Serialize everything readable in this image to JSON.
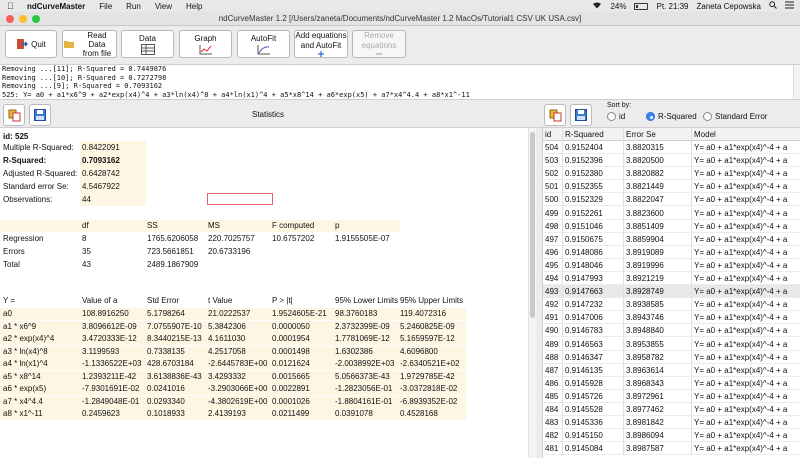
{
  "menubar": {
    "app": "ndCurveMaster",
    "menus": [
      "File",
      "Run",
      "View",
      "Help"
    ],
    "battery": "24%",
    "clock": "Pt. 21:39",
    "user": "Żaneta Cepowska"
  },
  "window": {
    "title": "ndCurveMaster 1.2 [/Users/zaneta/Documents/ndCurveMaster 1.2 MacOs/Tutorial1 CSV UK USA.csv]"
  },
  "toolbar": {
    "quit": "Quit",
    "read_data_1": "Read Data",
    "read_data_2": "from file",
    "data": "Data",
    "graph": "Graph",
    "autofit": "AutoFit",
    "add_eq_1": "Add equations",
    "add_eq_2": "and AutoFit",
    "remove_eq_1": "Remove",
    "remove_eq_2": "equations"
  },
  "log": [
    "Removing ...[11]; R-Squared = 0.7449876",
    "Removing ...[10]; R-Squared = 0.7272798",
    "Removing ...[9]; R-Squared = 0.7093162",
    "525: Y= a0  + a1*x6^9 + a2*exp(x4)^4 + a3*ln(x4)^8 + a4*ln(x1)^4 + a5*x8^14 + a6*exp(x5) + a7*x4^4.4 + a8*x1^-11"
  ],
  "stats": {
    "title": "Statistics",
    "id_label": "id: 525",
    "summary": [
      {
        "k": "Multiple R-Squared:",
        "v": "0.8422091"
      },
      {
        "k": "R-Squared:",
        "v": "0.7093162"
      },
      {
        "k": "Adjusted R-Squared:",
        "v": "0.6428742"
      },
      {
        "k": "Standard error Se:",
        "v": "4.5467922"
      },
      {
        "k": "Observations:",
        "v": "44"
      }
    ],
    "anova_header": [
      "",
      "df",
      "SS",
      "MS",
      "F computed",
      "p"
    ],
    "anova": [
      [
        "Regression",
        "8",
        "1765.6206058",
        "220.7025757",
        "10.6757202",
        "1.9155505E-07"
      ],
      [
        "Errors",
        "35",
        "723.5661851",
        "20.6733196",
        "",
        ""
      ],
      [
        "Total",
        "43",
        "2489.1867909",
        "",
        "",
        ""
      ]
    ],
    "coef_header": [
      "Y =",
      "Value of a",
      "Std Error",
      "t Value",
      "P > |t|",
      "95% Lower Limits",
      "95% Upper Limits"
    ],
    "coef": [
      [
        "a0",
        "108.8916250",
        "5.1798264",
        "21.0222537",
        "1.9524605E-21",
        "98.3760183",
        "119.4072316"
      ],
      [
        "a1 * x6^9",
        "3.8096612E-09",
        "7.0755907E-10",
        "5.3842306",
        "0.0000050",
        "2.3732399E-09",
        "5.2460825E-09"
      ],
      [
        "a2 * exp(x4)^4",
        "3.4720333E-12",
        "8.3440215E-13",
        "4.1611030",
        "0.0001954",
        "1.7781069E-12",
        "5.1659597E-12"
      ],
      [
        "a3 * ln(x4)^8",
        "3.1199593",
        "0.7338135",
        "4.2517058",
        "0.0001498",
        "1.6302386",
        "4.6096800"
      ],
      [
        "a4 * ln(x1)^4",
        "-1.1336522E+03",
        "428.6703184",
        "-2.6445783E+00",
        "0.0121624",
        "-2.0038992E+03",
        "-2.6340521E+02"
      ],
      [
        "a5 * x8^14",
        "1.2393211E-42",
        "3.6138836E-43",
        "3.4293332",
        "0.0015665",
        "5.0566373E-43",
        "1.9729785E-42"
      ],
      [
        "a6 * exp(x5)",
        "-7.9301691E-02",
        "0.0241016",
        "-3.2903066E+00",
        "0.0022891",
        "-1.2823056E-01",
        "-3.0372818E-02"
      ],
      [
        "a7 * x4^4.4",
        "-1.2849048E-01",
        "0.0293340",
        "-4.3802619E+00",
        "0.0001026",
        "-1.8804161E-01",
        "-6.8939352E-02"
      ],
      [
        "a8 * x1^-11",
        "0.2459623",
        "0.1018933",
        "2.4139193",
        "0.0211499",
        "0.0391078",
        "0.4528168"
      ]
    ]
  },
  "sort": {
    "label": "Sort by:",
    "options": [
      "id",
      "R-Squared",
      "Standard Error"
    ],
    "selected": "R-Squared"
  },
  "models": {
    "header": [
      "id",
      "R-Squared",
      "Error Se",
      "Model"
    ],
    "rows": [
      [
        "504",
        "0.9152404",
        "3.8820315",
        "Y= a0  + a1*exp(x4)^-4 + a"
      ],
      [
        "503",
        "0.9152396",
        "3.8820500",
        "Y= a0  + a1*exp(x4)^-4 + a"
      ],
      [
        "502",
        "0.9152380",
        "3.8820882",
        "Y= a0  + a1*exp(x4)^-4 + a"
      ],
      [
        "501",
        "0.9152355",
        "3.8821449",
        "Y= a0  + a1*exp(x4)^-4 + a"
      ],
      [
        "500",
        "0.9152329",
        "3.8822047",
        "Y= a0  + a1*exp(x4)^-4 + a"
      ],
      [
        "499",
        "0.9152261",
        "3.8823600",
        "Y= a0  + a1*exp(x4)^-4 + a"
      ],
      [
        "498",
        "0.9151046",
        "3.8851409",
        "Y= a0  + a1*exp(x4)^-4 + a"
      ],
      [
        "497",
        "0.9150675",
        "3.8859904",
        "Y= a0  + a1*exp(x4)^-4 + a"
      ],
      [
        "496",
        "0.9148086",
        "3.8919089",
        "Y= a0  + a1*exp(x4)^-4 + a"
      ],
      [
        "495",
        "0.9148046",
        "3.8919996",
        "Y= a0  + a1*exp(x4)^-4 + a"
      ],
      [
        "494",
        "0.9147993",
        "3.8921219",
        "Y= a0  + a1*exp(x4)^-4 + a"
      ],
      [
        "493",
        "0.9147663",
        "3.8928749",
        "Y= a0  + a1*exp(x4)^-4 + a"
      ],
      [
        "492",
        "0.9147232",
        "3.8938585",
        "Y= a0  + a1*exp(x4)^-4 + a"
      ],
      [
        "491",
        "0.9147006",
        "3.8943746",
        "Y= a0  + a1*exp(x4)^-4 + a"
      ],
      [
        "490",
        "0.9146783",
        "3.8948840",
        "Y= a0  + a1*exp(x4)^-4 + a"
      ],
      [
        "489",
        "0.9146563",
        "3.8953855",
        "Y= a0  + a1*exp(x4)^-4 + a"
      ],
      [
        "488",
        "0.9146347",
        "3.8958782",
        "Y= a0  + a1*exp(x4)^-4 + a"
      ],
      [
        "487",
        "0.9146135",
        "3.8963614",
        "Y= a0  + a1*exp(x4)^-4 + a"
      ],
      [
        "486",
        "0.9145928",
        "3.8968343",
        "Y= a0  + a1*exp(x4)^-4 + a"
      ],
      [
        "485",
        "0.9145726",
        "3.8972961",
        "Y= a0  + a1*exp(x4)^-4 + a"
      ],
      [
        "484",
        "0.9145528",
        "3.8977462",
        "Y= a0  + a1*exp(x4)^-4 + a"
      ],
      [
        "483",
        "0.9145336",
        "3.8981842",
        "Y= a0  + a1*exp(x4)^-4 + a"
      ],
      [
        "482",
        "0.9145150",
        "3.8986094",
        "Y= a0  + a1*exp(x4)^-4 + a"
      ],
      [
        "481",
        "0.9145084",
        "3.8987587",
        "Y= a0  + a1*exp(x4)^-4 + a"
      ]
    ]
  },
  "colors": {
    "traffic_close": "#fc5f57",
    "traffic_min": "#fdbc2e",
    "traffic_max": "#28c840",
    "accent": "#3b82f6",
    "highlight": "#fdf6e3"
  }
}
